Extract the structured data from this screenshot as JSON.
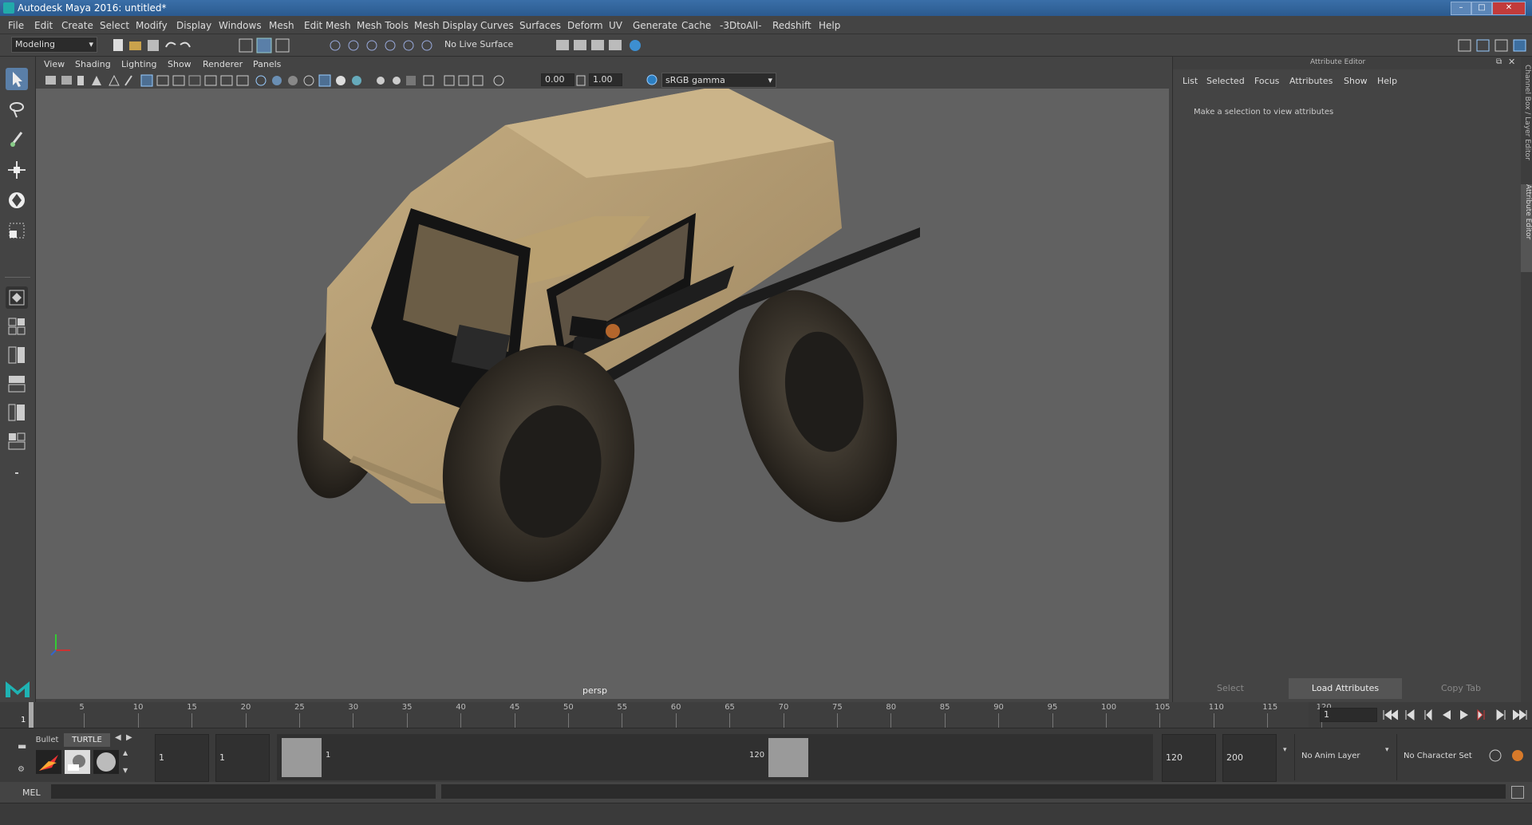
{
  "window": {
    "title": "Autodesk Maya 2016: untitled*"
  },
  "menu": [
    "File",
    "Edit",
    "Create",
    "Select",
    "Modify",
    "Display",
    "Windows",
    "Mesh",
    "Edit Mesh",
    "Mesh Tools",
    "Mesh Display",
    "Curves",
    "Surfaces",
    "Deform",
    "UV",
    "Generate",
    "Cache",
    "-3DtoAll-",
    "Redshift",
    "Help"
  ],
  "shelf": {
    "mode": "Modeling",
    "live_surface": "No Live Surface"
  },
  "viewport": {
    "menu": [
      "View",
      "Shading",
      "Lighting",
      "Show",
      "Renderer",
      "Panels"
    ],
    "exposure": "0.00",
    "gamma": "1.00",
    "color_space": "sRGB gamma",
    "camera": "persp"
  },
  "attribute_editor": {
    "title": "Attribute Editor",
    "menu": [
      "List",
      "Selected",
      "Focus",
      "Attributes",
      "Show",
      "Help"
    ],
    "message": "Make a selection to view attributes",
    "buttons": {
      "select": "Select",
      "load": "Load Attributes",
      "copy": "Copy Tab"
    }
  },
  "side_tabs": {
    "channel_box": "Channel Box / Layer Editor",
    "attribute_editor": "Attribute Editor"
  },
  "timeline": {
    "ticks": [
      "5",
      "10",
      "15",
      "20",
      "25",
      "30",
      "35",
      "40",
      "45",
      "50",
      "55",
      "60",
      "65",
      "70",
      "75",
      "80",
      "85",
      "90",
      "95",
      "100",
      "105",
      "110",
      "115",
      "120"
    ],
    "current_frame_marker": "1",
    "current_frame": "1"
  },
  "range": {
    "shelf_tabs": [
      "Bullet",
      "TURTLE"
    ],
    "start_frame": "1",
    "playback_start": "1",
    "slider_start": "1",
    "slider_end": "120",
    "playback_end": "120",
    "end_frame": "200",
    "anim_layer": "No Anim Layer",
    "character_set": "No Character Set"
  },
  "command_line": {
    "label": "MEL"
  },
  "colors": {
    "accent": "#4a8fd6",
    "viewport_bg": "#616161",
    "panel": "#444444",
    "vehicle_body": "#b39a6c"
  }
}
